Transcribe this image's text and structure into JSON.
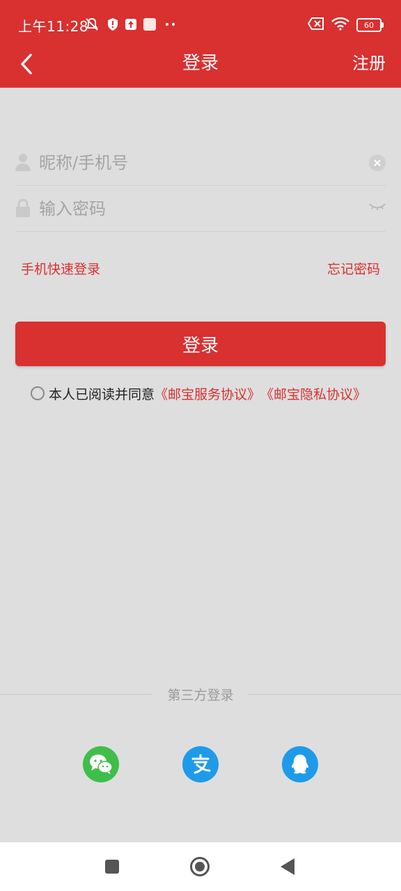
{
  "status_bar": {
    "time": "上午11:28",
    "battery": "60"
  },
  "header": {
    "title": "登录",
    "register_label": "注册"
  },
  "form": {
    "username_placeholder": "昵称/手机号",
    "password_placeholder": "输入密码",
    "quick_login_label": "手机快速登录",
    "forgot_password_label": "忘记密码",
    "login_button_label": "登录"
  },
  "agreement": {
    "text": "本人已阅读并同意",
    "service_link": "《邮宝服务协议》",
    "privacy_link": "《邮宝隐私协议》"
  },
  "third_party": {
    "title": "第三方登录",
    "providers": [
      "wechat-icon",
      "alipay-icon",
      "qq-icon"
    ]
  },
  "colors": {
    "primary": "#d93030",
    "background": "#dedede",
    "wechat": "#3fbe4a",
    "alipay": "#1e9be8",
    "qq": "#1e9be8"
  }
}
